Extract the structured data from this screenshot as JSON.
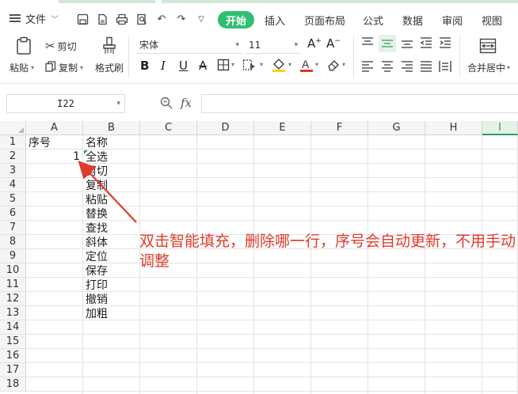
{
  "menubar": {
    "file_label": "文件",
    "tabs": [
      {
        "label": "开始",
        "active": true
      },
      {
        "label": "插入",
        "active": false
      },
      {
        "label": "页面布局",
        "active": false
      },
      {
        "label": "公式",
        "active": false
      },
      {
        "label": "数据",
        "active": false
      },
      {
        "label": "审阅",
        "active": false
      },
      {
        "label": "视图",
        "active": false
      }
    ],
    "accent": "#2fbf71"
  },
  "ribbon": {
    "paste_label": "粘贴",
    "cut_label": "剪切",
    "copy_label": "复制",
    "format_painter_label": "格式刷",
    "font_name": "宋体",
    "font_size": "11",
    "merge_label": "合并居中",
    "font_color": "#e03a2a",
    "fill_color": "#f5d400"
  },
  "formula_bar": {
    "cell_ref": "I22",
    "fx_label": "fx",
    "value": ""
  },
  "sheet": {
    "columns": [
      "A",
      "B",
      "C",
      "D",
      "E",
      "F",
      "G",
      "H",
      "I"
    ],
    "selected_column": "I",
    "rows": [
      "1",
      "2",
      "3",
      "4",
      "5",
      "6",
      "7",
      "8",
      "9",
      "10",
      "11",
      "12",
      "13",
      "14",
      "15",
      "16",
      "17",
      "18"
    ],
    "a1": "序号",
    "b1": "名称",
    "a2": "1",
    "names": [
      "全选",
      "剪切",
      "复制",
      "粘贴",
      "替换",
      "查找",
      "斜体",
      "定位",
      "保存",
      "打印",
      "撤销",
      "加粗"
    ]
  },
  "annotation": {
    "text": "双击智能填充，删除哪一行，序号会自动更新，不用手动调整",
    "color": "#e03a2a"
  }
}
